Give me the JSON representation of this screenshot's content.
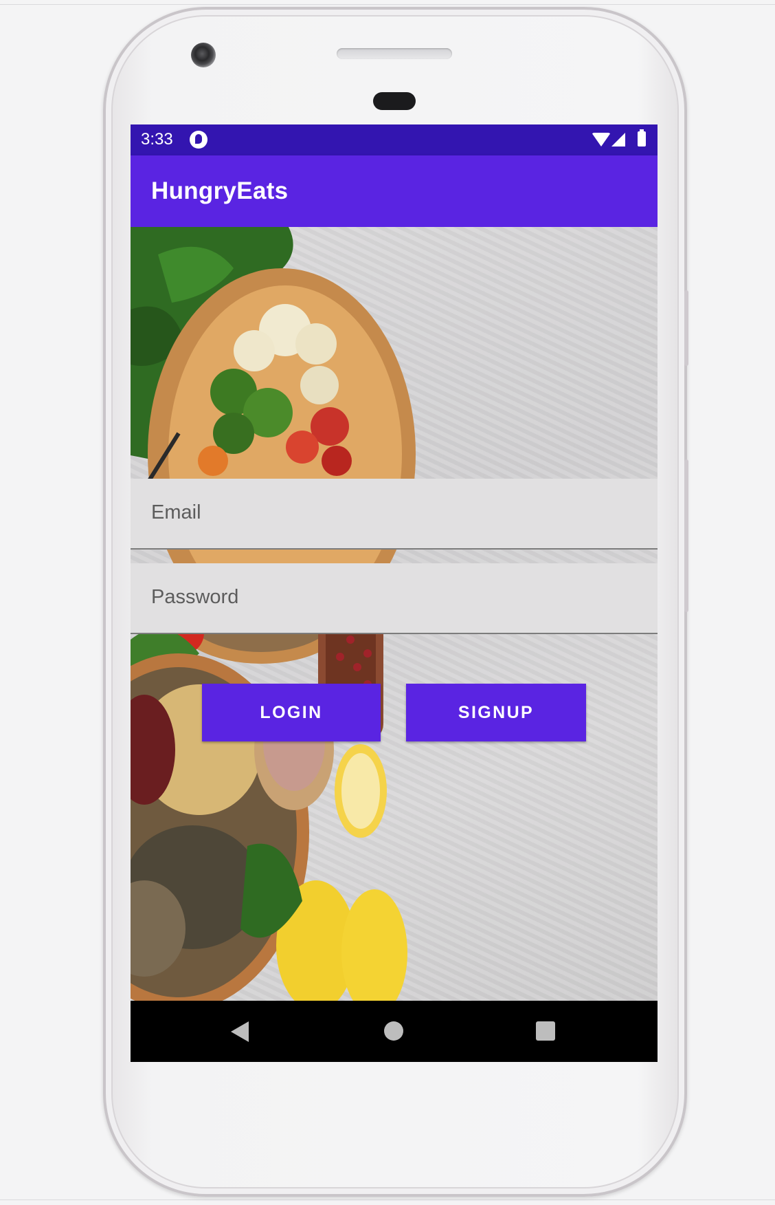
{
  "status_bar": {
    "time": "3:33",
    "icons": [
      "app-notification-icon",
      "wifi-icon",
      "signal-icon",
      "battery-icon"
    ],
    "color": "#3315b0"
  },
  "app_bar": {
    "title": "HungryEats",
    "color": "#5a24e2"
  },
  "form": {
    "email": {
      "placeholder": "Email",
      "value": ""
    },
    "password": {
      "placeholder": "Password",
      "value": ""
    }
  },
  "buttons": {
    "login_label": "LOGIN",
    "signup_label": "SIGNUP",
    "color": "#5a24e2"
  },
  "nav_bar": {
    "icons": [
      "back-icon",
      "home-icon",
      "recents-icon"
    ]
  }
}
